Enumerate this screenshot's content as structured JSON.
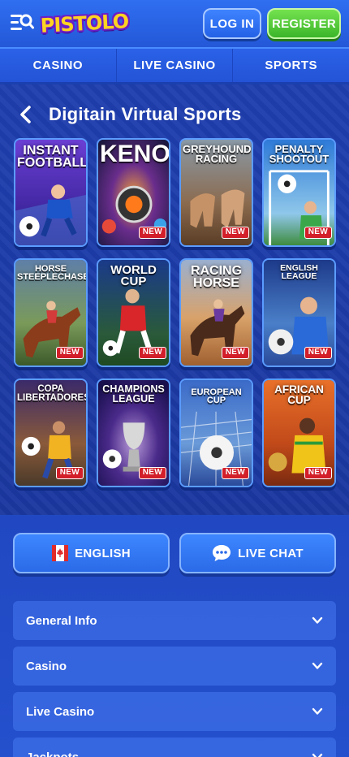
{
  "header": {
    "logo_text": "PISTOLO",
    "login_label": "LOG IN",
    "register_label": "REGISTER"
  },
  "nav": {
    "tabs": [
      {
        "label": "CASINO"
      },
      {
        "label": "LIVE CASINO"
      },
      {
        "label": "SPORTS"
      }
    ]
  },
  "page": {
    "title": "Digitain Virtual Sports"
  },
  "games": [
    {
      "title": "INSTANT FOOTBALL",
      "badge": ""
    },
    {
      "title": "KENO",
      "badge": "NEW"
    },
    {
      "title": "GREYHOUND RACING",
      "badge": "NEW"
    },
    {
      "title": "PENALTY SHOOTOUT",
      "badge": "NEW"
    },
    {
      "title": "HORSE STEEPLECHASE",
      "badge": "NEW"
    },
    {
      "title": "WORLD CUP",
      "badge": "NEW"
    },
    {
      "title": "RACING HORSE",
      "badge": "NEW"
    },
    {
      "title": "ENGLISH LEAGUE",
      "badge": "NEW"
    },
    {
      "title": "COPA LIBERTADORES",
      "badge": "NEW"
    },
    {
      "title": "CHAMPIONS LEAGUE",
      "badge": "NEW"
    },
    {
      "title": "EUROPEAN CUP",
      "badge": "NEW"
    },
    {
      "title": "AFRICAN CUP",
      "badge": "NEW"
    }
  ],
  "footer": {
    "language_label": "ENGLISH",
    "chat_label": "LIVE CHAT",
    "accordion": [
      {
        "label": "General Info"
      },
      {
        "label": "Casino"
      },
      {
        "label": "Live Casino"
      },
      {
        "label": "Jackpots"
      }
    ]
  },
  "colors": {
    "primary_blue": "#2a62e8",
    "register_green": "#3cb52a",
    "badge_red": "#d21f2a",
    "logo_yellow": "#ffd321"
  }
}
